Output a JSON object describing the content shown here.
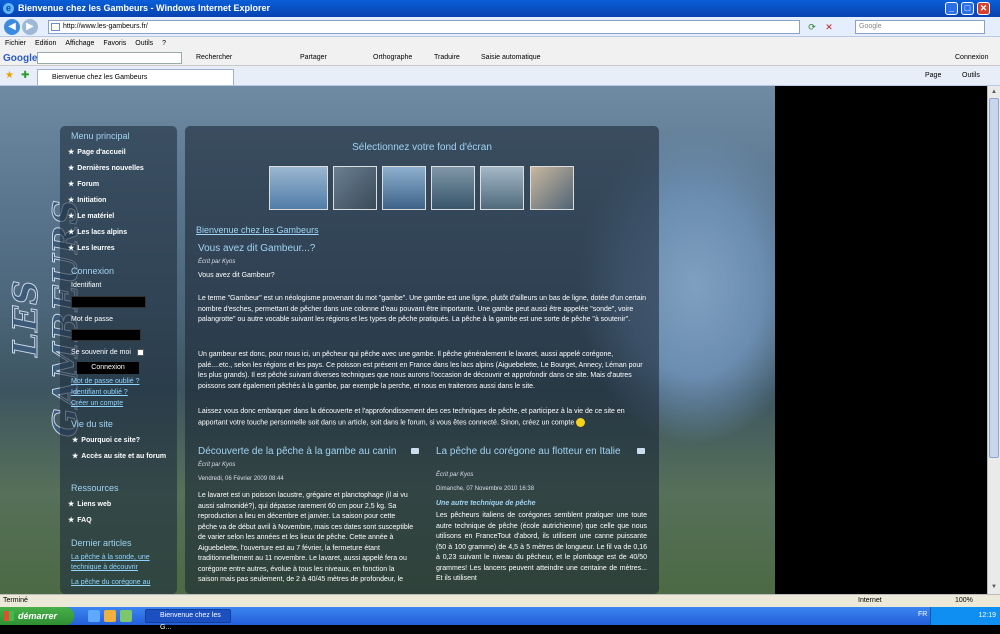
{
  "window": {
    "title": "Bienvenue chez les Gambeurs - Windows Internet Explorer",
    "min": "_",
    "max": "□",
    "close": "✕"
  },
  "address": {
    "url": "http://www.les-gambeurs.fr/",
    "search_placeholder": "Google"
  },
  "menu": [
    "Fichier",
    "Edition",
    "Affichage",
    "Favoris",
    "Outils",
    "?"
  ],
  "google_toolbar": {
    "logo": "Google",
    "search": "Rechercher",
    "share": "Partager",
    "spell": "Orthographe",
    "translate": "Traduire",
    "autofill": "Saisie automatique",
    "login": "Connexion"
  },
  "tabs": {
    "current": "Bienvenue chez les Gambeurs",
    "page_btn": "Page",
    "tools_btn": "Outils"
  },
  "site": {
    "brand": "LES GAMBEURS",
    "menu_title": "Menu principal",
    "menu_items": [
      "Page d'accueil",
      "Dernières nouvelles",
      "Forum",
      "Initiation",
      "Le matériel",
      "Les lacs alpins",
      "Les leurres"
    ],
    "login": {
      "title": "Connexion",
      "user_label": "Identifiant",
      "pass_label": "Mot de passe",
      "remember": "Se souvenir de moi",
      "button": "Connexion",
      "forgot_pass": "Mot de passe oublié ?",
      "forgot_user": "Identifiant oublié ?",
      "create": "Créer un compte"
    },
    "life_title": "Vie du site",
    "life_items": [
      "Pourquoi ce site?",
      "Accès au site et au forum"
    ],
    "resources_title": "Ressources",
    "resources_items": [
      "Liens web",
      "FAQ"
    ],
    "latest_title": "Dernier articles",
    "latest_items": [
      "La pêche à la sonde, une technique à découvrir",
      "La pêche du corégone au"
    ]
  },
  "main": {
    "wallpaper_title": "Sélectionnez votre fond d'écran",
    "welcome": "Bienvenue chez les Gambeurs",
    "article1": {
      "title": "Vous avez dit Gambeur...?",
      "author": "Écrit par Kyos",
      "p1": "Vous avez dit Gambeur?",
      "p2": "Le terme \"Gambeur\" est un néologisme provenant du mot \"gambe\". Une gambe est une ligne, plutôt d'ailleurs un bas de ligne, dotée d'un certain nombre d'esches, permettant de pêcher dans une colonne d'eau pouvant être importante. Une gambe peut aussi être appelée \"sonde\", voire palangrotte\" ou autre vocable suivant les régions et les types de pêche pratiqués. La pêche à la gambe est une sorte de pêche \"à soutenir\".",
      "p3": "Un gambeur est donc, pour nous ici, un pêcheur qui pêche avec une gambe. Il pêche généralement le lavaret, aussi appelé corégone, palé....etc., selon les régions et les pays. Ce poisson est présent en France dans les lacs alpins (Aiguebelette, Le Bourget, Annecy, Léman pour les plus grands). Il est pêché suivant diverses techniques que nous aurons l'occasion de découvrir et approfondir dans ce site. Mais d'autres poissons sont également pêchés à la gambe, par exemple la perche, et nous en traiterons aussi dans le site.",
      "p4": "Laissez vous donc embarquer dans la découverte et l'approfondissement des ces techniques de pêche, et participez à la vie de ce site en apportant votre touche personnelle soit dans un article, soit dans le forum, si vous êtes connecté. Sinon, créez un compte"
    },
    "article2": {
      "title": "Découverte de la pêche à la gambe au canin",
      "author": "Écrit par Kyos",
      "date": "Vendredi, 06 Février 2009 08:44",
      "text": "Le lavaret est un poisson lacustre, grégaire et planctophage (il ai vu aussi salmonidé?), qui dépasse rarement 60 cm pour 2,5 kg. Sa reproduction a lieu en décembre et janvier. La saison pour cette pêche va de début avril à Novembre, mais ces dates sont susceptible de varier selon les années et les lieux de pêche. Cette année à Aiguebelette, l'ouverture est au 7 février, la fermeture étant traditionnellement au 11 novembre. Le lavaret, aussi appelé fera ou corégone entre autres, évolue à tous les niveaux, en fonction la saison mais pas seulement, de 2 à 40/45 mètres de profondeur, le"
    },
    "article3": {
      "title": "La pêche du corégone au flotteur en Italie",
      "author": "Écrit par Kyos",
      "date": "Dimanche, 07 Novembre 2010 16:38",
      "subtitle": "Une autre technique de pêche",
      "text": "Les pêcheurs italiens de corégones semblent pratiquer une toute autre technique de pêche (école autrichienne) que celle que nous utilisons en FranceTout d'abord, ils utilisent une canne puissante (50 à 100 gramme) de 4,5 à 5 mètres de longueur. Le fil va de 0,16 à 0,23 suivant le niveau du pêcheur, et le plombage est de 40/50 grammes! Les lancers peuvent atteindre une centaine de mètres... Et ils utilisent"
    }
  },
  "status": {
    "text": "Terminé",
    "zone": "Internet",
    "zoom": "100%"
  },
  "taskbar": {
    "start": "démarrer",
    "task": "Bienvenue chez les G...",
    "lang": "FR",
    "clock": "12:19"
  }
}
